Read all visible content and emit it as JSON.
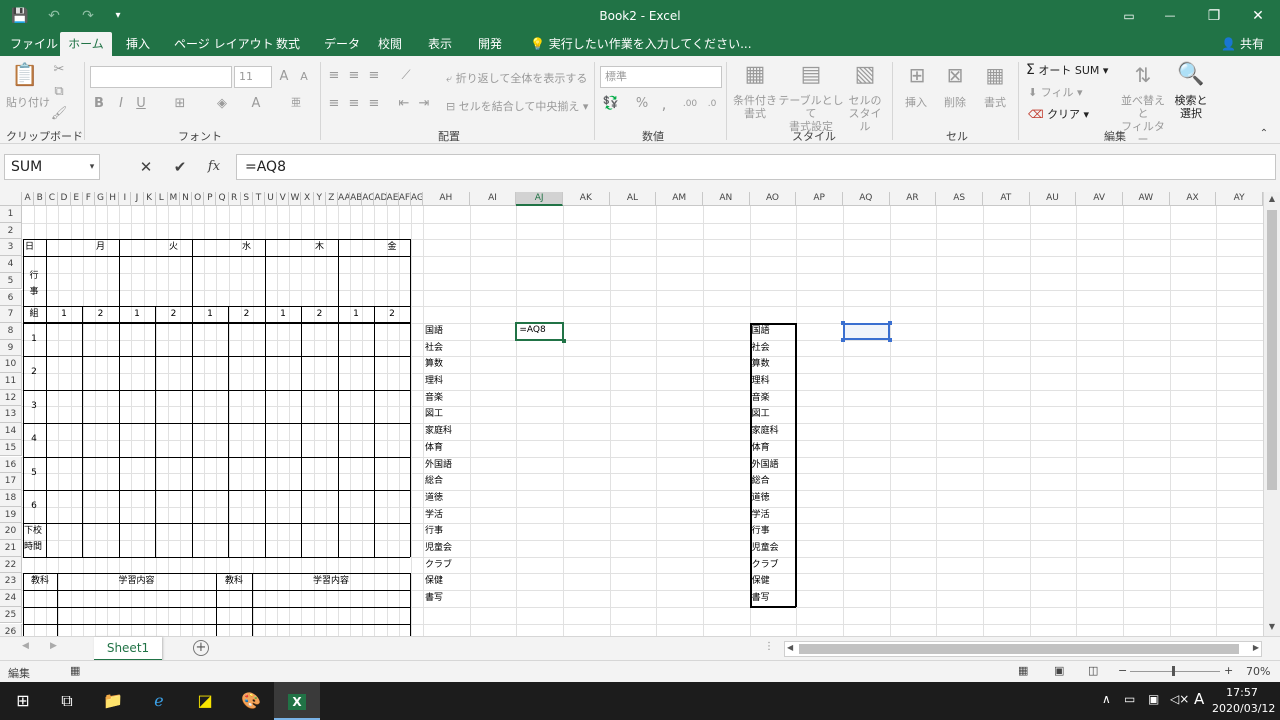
{
  "window": {
    "title": "Book2 - Excel",
    "qat": {
      "save": "💾",
      "undo": "↶",
      "redo": "↷",
      "more": "▾"
    },
    "controls": {
      "ribbon_opt": "▭",
      "minimize": "—",
      "restore": "❐",
      "close": "✕"
    }
  },
  "tabs": [
    "ファイル",
    "ホーム",
    "挿入",
    "ページ レイアウト",
    "数式",
    "データ",
    "校閲",
    "表示",
    "開発"
  ],
  "tellme": "実行したい作業を入力してください...",
  "share": "共有",
  "ribbon": {
    "clipboard": {
      "label": "クリップボード",
      "paste": "貼り付け"
    },
    "font": {
      "label": "フォント",
      "size": "11",
      "bold": "B",
      "italic": "I",
      "underline": "U"
    },
    "alignment": {
      "label": "配置",
      "wrap": "折り返して全体を表示する",
      "merge": "セルを結合して中央揃え"
    },
    "number": {
      "label": "数値",
      "format": "標準"
    },
    "styles": {
      "label": "スタイル",
      "conditional": "条件付き\n書式",
      "table": "テーブルとして\n書式設定",
      "cell_styles": "セルの\nスタイル"
    },
    "cells": {
      "label": "セル",
      "insert": "挿入",
      "delete": "削除",
      "format": "書式"
    },
    "editing": {
      "label": "編集",
      "autosum": "オート SUM",
      "fill": "フィル",
      "clear": "クリア",
      "sort": "並べ替えと\nフィルター",
      "find": "検索と\n選択"
    }
  },
  "formula_bar": {
    "name_box": "SUM",
    "cancel": "✕",
    "enter": "✔",
    "fx": "fx",
    "formula": "=AQ8"
  },
  "grid": {
    "columns_narrow": [
      "A",
      "B",
      "C",
      "D",
      "E",
      "F",
      "G",
      "H",
      "I",
      "J",
      "K",
      "L",
      "M",
      "N",
      "O",
      "P",
      "Q",
      "R",
      "S",
      "T",
      "U",
      "V",
      "W",
      "X",
      "Y",
      "Z",
      "AA",
      "AB",
      "AC",
      "AD",
      "AE",
      "AF",
      "AG"
    ],
    "columns_wide": [
      "AH",
      "AI",
      "AJ",
      "AK",
      "AL",
      "AM",
      "AN",
      "AO",
      "AP",
      "AQ",
      "AR",
      "AS",
      "AT",
      "AU",
      "AV",
      "AW",
      "AX",
      "AY"
    ],
    "rows": [
      "1",
      "2",
      "3",
      "4",
      "5",
      "6",
      "7",
      "8",
      "9",
      "10",
      "11",
      "12",
      "13",
      "14",
      "15",
      "16",
      "17",
      "18",
      "19",
      "20",
      "21",
      "22",
      "23",
      "24",
      "25",
      "26"
    ],
    "timetable": {
      "day_label": "日",
      "days": [
        "月",
        "火",
        "水",
        "木",
        "金"
      ],
      "event_label": "行\n事",
      "group_label": "組",
      "groups": [
        "1",
        "2",
        "1",
        "2",
        "1",
        "2",
        "1",
        "2",
        "1",
        "2"
      ],
      "periods": [
        "1",
        "2",
        "3",
        "4",
        "5",
        "6"
      ],
      "after_school": "下校\n時間",
      "footer": [
        "教科",
        "学習内容",
        "教科",
        "学習内容"
      ]
    },
    "subjects": [
      "国語",
      "社会",
      "算数",
      "理科",
      "音楽",
      "図工",
      "家庭科",
      "体育",
      "外国語",
      "総合",
      "道徳",
      "学活",
      "行事",
      "児童会",
      "クラブ",
      "保健",
      "書写"
    ],
    "editing_cell": "=AQ8"
  },
  "sheet_tabs": [
    "Sheet1"
  ],
  "status": {
    "mode": "編集",
    "zoom": "70%"
  },
  "taskbar": {
    "time": "17:57",
    "date": "2020/03/12",
    "ime": "A"
  }
}
